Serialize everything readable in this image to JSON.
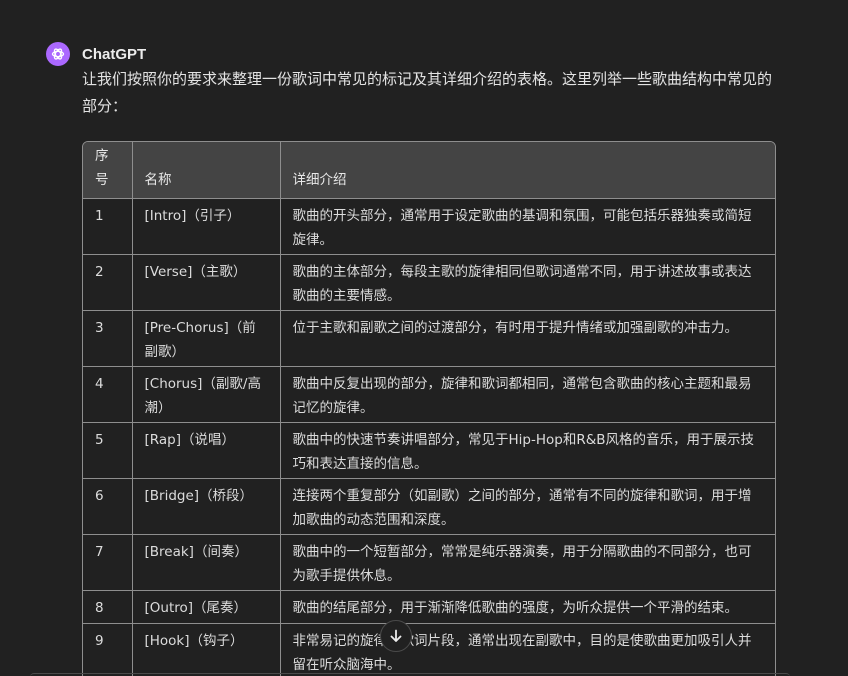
{
  "message": {
    "author": "ChatGPT",
    "intro": "让我们按照你的要求来整理一份歌词中常见的标记及其详细介绍的表格。这里列举一些歌曲结构中常见的部分："
  },
  "table": {
    "headers": [
      "序号",
      "名称",
      "详细介绍"
    ],
    "rows": [
      {
        "num": "1",
        "name": "[Intro]（引子）",
        "desc": "歌曲的开头部分，通常用于设定歌曲的基调和氛围，可能包括乐器独奏或简短旋律。"
      },
      {
        "num": "2",
        "name": "[Verse]（主歌）",
        "desc": "歌曲的主体部分，每段主歌的旋律相同但歌词通常不同，用于讲述故事或表达歌曲的主要情感。"
      },
      {
        "num": "3",
        "name": "[Pre-Chorus]（前副歌）",
        "desc": "位于主歌和副歌之间的过渡部分，有时用于提升情绪或加强副歌的冲击力。"
      },
      {
        "num": "4",
        "name": "[Chorus]（副歌/高潮）",
        "desc": "歌曲中反复出现的部分，旋律和歌词都相同，通常包含歌曲的核心主题和最易记忆的旋律。"
      },
      {
        "num": "5",
        "name": "[Rap]（说唱）",
        "desc": "歌曲中的快速节奏讲唱部分，常见于Hip-Hop和R&B风格的音乐，用于展示技巧和表达直接的信息。"
      },
      {
        "num": "6",
        "name": "[Bridge]（桥段）",
        "desc": "连接两个重复部分（如副歌）之间的部分，通常有不同的旋律和歌词，用于增加歌曲的动态范围和深度。"
      },
      {
        "num": "7",
        "name": "[Break]（间奏）",
        "desc": "歌曲中的一个短暂部分，常常是纯乐器演奏，用于分隔歌曲的不同部分，也可为歌手提供休息。"
      },
      {
        "num": "8",
        "name": "[Outro]（尾奏）",
        "desc": "歌曲的结尾部分，用于渐渐降低歌曲的强度，为听众提供一个平滑的结束。"
      },
      {
        "num": "9",
        "name": "[Hook]（钩子）",
        "desc": "非常易记的旋律或歌词片段，通常出现在副歌中，目的是使歌曲更加吸引人并留在听众脑海中。"
      }
    ]
  },
  "icons": {
    "avatar": "openai-logo-icon",
    "scroll": "arrow-down-icon"
  },
  "colors": {
    "background": "#212121",
    "avatar": "#ab68ff",
    "table_header": "#444444",
    "border": "#8e8e8e"
  }
}
